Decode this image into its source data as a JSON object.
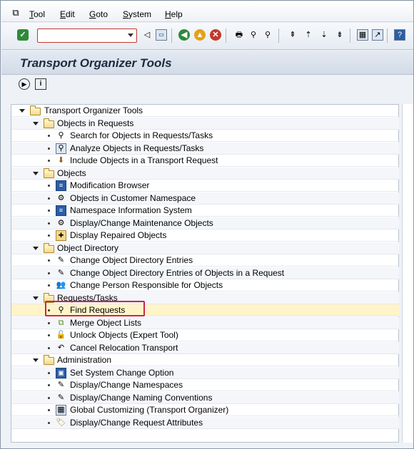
{
  "menubar": {
    "items": [
      {
        "label": "Tool",
        "underline": "T"
      },
      {
        "label": "Edit",
        "underline": "E"
      },
      {
        "label": "Goto",
        "underline": "G"
      },
      {
        "label": "System",
        "underline": "S"
      },
      {
        "label": "Help",
        "underline": "H"
      }
    ]
  },
  "toolbar": {
    "command_field_value": "",
    "icons": [
      "enter-icon",
      "back-arrow-icon",
      "save-icon",
      "back-icon",
      "exit-icon",
      "cancel-icon",
      "print-icon",
      "find-icon",
      "find-next-icon",
      "first-page-icon",
      "previous-page-icon",
      "next-page-icon",
      "last-page-icon",
      "create-session-icon",
      "shortcut-icon",
      "help-icon"
    ]
  },
  "page": {
    "title": "Transport Organizer Tools"
  },
  "app_toolbar": {
    "icons": [
      "execute-icon",
      "info-icon"
    ]
  },
  "tree": {
    "root": "Transport Organizer Tools",
    "groups": [
      {
        "label": "Objects in Requests",
        "items": [
          {
            "label": "Search for Objects in Requests/Tasks",
            "icon": "search-binoculars-icon"
          },
          {
            "label": "Analyze Objects in Requests/Tasks",
            "icon": "analyze-icon"
          },
          {
            "label": "Include Objects in a Transport Request",
            "icon": "include-icon"
          }
        ]
      },
      {
        "label": "Objects",
        "items": [
          {
            "label": "Modification Browser",
            "icon": "browser-icon"
          },
          {
            "label": "Objects in Customer Namespace",
            "icon": "objects-icon"
          },
          {
            "label": "Namespace Information System",
            "icon": "info-system-icon"
          },
          {
            "label": "Display/Change Maintenance Objects",
            "icon": "objects-icon"
          },
          {
            "label": "Display Repaired Objects",
            "icon": "repaired-icon"
          }
        ]
      },
      {
        "label": "Object Directory",
        "items": [
          {
            "label": "Change Object Directory Entries",
            "icon": "pencil-icon"
          },
          {
            "label": "Change Object Directory Entries of Objects in a Request",
            "icon": "pencil-icon"
          },
          {
            "label": "Change Person Responsible for Objects",
            "icon": "person-icon"
          }
        ]
      },
      {
        "label": "Requests/Tasks",
        "items": [
          {
            "label": "Find Requests",
            "icon": "binoculars-icon"
          },
          {
            "label": "Merge Object Lists",
            "icon": "merge-icon"
          },
          {
            "label": "Unlock Objects (Expert Tool)",
            "icon": "unlock-icon"
          },
          {
            "label": "Cancel Relocation Transport",
            "icon": "cancel-relocation-icon"
          }
        ]
      },
      {
        "label": "Administration",
        "items": [
          {
            "label": "Set System Change Option",
            "icon": "system-change-icon"
          },
          {
            "label": "Display/Change Namespaces",
            "icon": "pencil-icon"
          },
          {
            "label": "Display/Change Naming Conventions",
            "icon": "pencil-icon"
          },
          {
            "label": "Global Customizing (Transport Organizer)",
            "icon": "table-icon"
          },
          {
            "label": "Display/Change Request Attributes",
            "icon": "tag-icon"
          }
        ]
      }
    ]
  },
  "highlight": {
    "item": "Find Requests",
    "color": "#c8264a"
  }
}
